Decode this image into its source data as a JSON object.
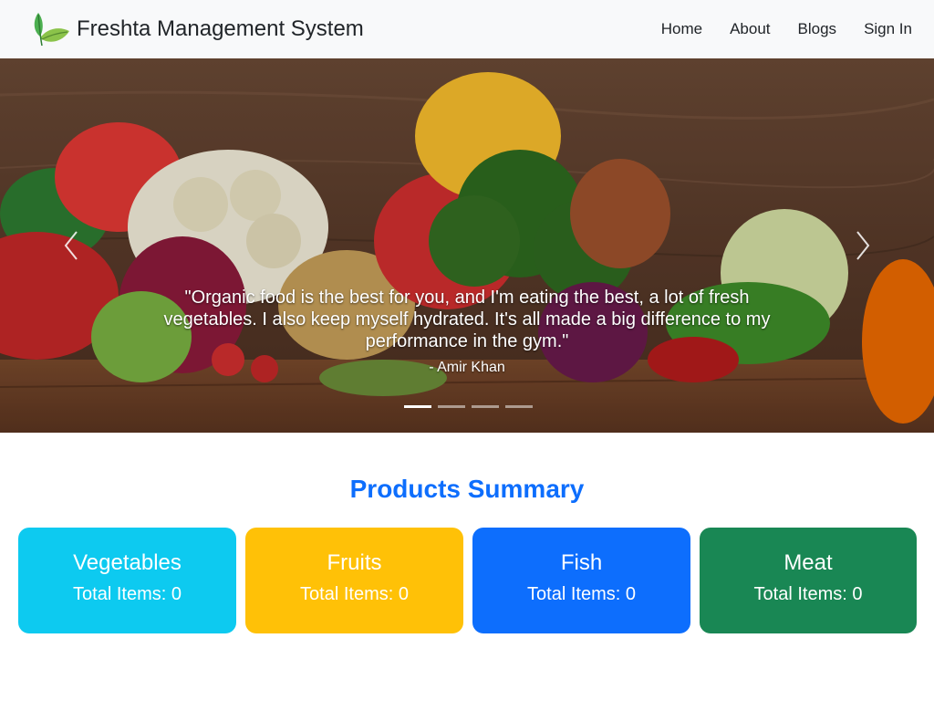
{
  "navbar": {
    "brand": "Freshta Management System",
    "links": [
      "Home",
      "About",
      "Blogs",
      "Sign In"
    ]
  },
  "carousel": {
    "quote": "\"Organic food is the best for you, and I'm eating the best, a lot of fresh vegetables. I also keep myself hydrated. It's all made a big difference to my performance in the gym.\"",
    "author": "- Amir Khan",
    "slides": 4,
    "active_slide": 1
  },
  "summary": {
    "title": "Products Summary",
    "cards": [
      {
        "name": "Vegetables",
        "count": "Total Items: 0",
        "color": "#0dcaf0"
      },
      {
        "name": "Fruits",
        "count": "Total Items: 0",
        "color": "#ffc107"
      },
      {
        "name": "Fish",
        "count": "Total Items: 0",
        "color": "#0d6efd"
      },
      {
        "name": "Meat",
        "count": "Total Items: 0",
        "color": "#198754"
      }
    ]
  },
  "icons": {
    "logo": "leaf-logo-icon",
    "prev": "chevron-left-icon",
    "next": "chevron-right-icon"
  }
}
